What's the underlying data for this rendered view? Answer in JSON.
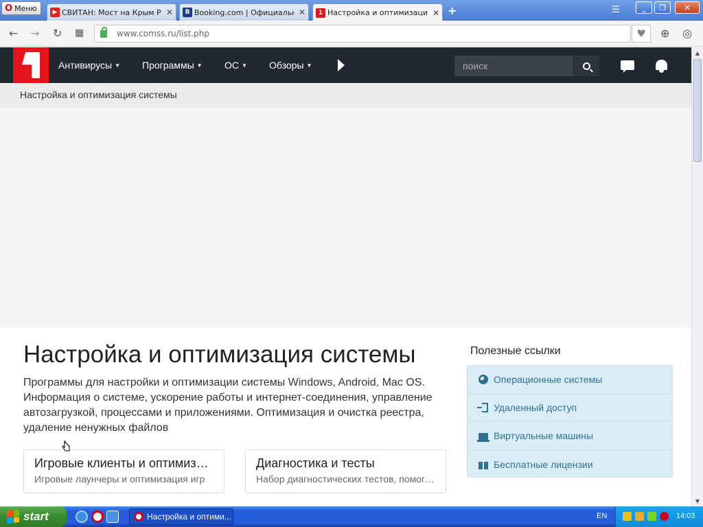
{
  "browser": {
    "menu_label": "Меню",
    "tabs": [
      {
        "title": "СВИТАН: Мост на Крым P",
        "favicon": "youtube-icon",
        "favicon_color": "#e62117"
      },
      {
        "title": "Booking.com | Официальны",
        "favicon": "booking-icon",
        "favicon_color": "#1c3d8c",
        "favicon_text": "B"
      },
      {
        "title": "Настройка и оптимизация с",
        "favicon": "comss-icon",
        "favicon_color": "#e3171b",
        "active": true
      }
    ],
    "url": "www.comss.ru/list.php"
  },
  "site": {
    "nav": [
      "Антивирусы",
      "Программы",
      "ОС",
      "Обзоры"
    ],
    "search_placeholder": "поиск",
    "breadcrumb": "Настройка и оптимизация системы",
    "title": "Настройка и оптимизация системы",
    "description": "Программы для настройки и оптимизации системы Windows, Android, Mac OS. Информация о системе, ускорение работы и интернет-соединения, управление автозагрузкой, процессами и приложениями. Оптимизация и очистка реестра, удаление ненужных файлов",
    "cards": [
      {
        "title": "Игровые клиенты и оптимизация игр",
        "subtitle": "Игровые лаунчеры и оптимизация игр"
      },
      {
        "title": "Диагностика и тесты",
        "subtitle": "Набор диагностических тестов, помогающих"
      }
    ],
    "sidebar": {
      "title": "Полезные ссылки",
      "links": [
        {
          "label": "Операционные системы",
          "icon": "globe-icon"
        },
        {
          "label": "Удаленный доступ",
          "icon": "sign-in-icon"
        },
        {
          "label": "Виртуальные машины",
          "icon": "laptop-icon"
        },
        {
          "label": "Бесплатные лицензии",
          "icon": "gift-icon"
        }
      ]
    },
    "colors": {
      "brand": "#e3171b",
      "header": "#222831",
      "links_bg": "#d9edf7",
      "links_text": "#31708f"
    }
  },
  "taskbar": {
    "start_label": "start",
    "task_title": "Настройка и оптими...",
    "language": "EN",
    "clock": "14:03"
  }
}
